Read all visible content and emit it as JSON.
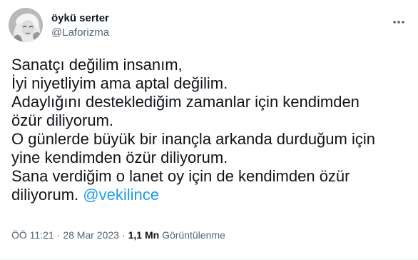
{
  "author": {
    "display_name": "öykü serter",
    "handle": "@Laforizma"
  },
  "tweet": {
    "lines": [
      "Sanatçı değilim insanım,",
      "İyi niyetliyim ama aptal değilim.",
      "Adaylığını desteklediğim zamanlar için kendimden",
      "özür diliyorum.",
      "O günlerde büyük bir inançla arkanda durduğum için",
      "yine kendimden özür diliyorum.",
      "Sana verdiğim o lanet oy için de kendimden özür"
    ],
    "last_line_text": "diliyorum.",
    "mention": "@vekilince"
  },
  "meta": {
    "time": "ÖÖ 11:21",
    "separator": "·",
    "date": "28 Mar 2023",
    "views_count": "1,1 Mn",
    "views_label": "Görüntülenme"
  },
  "icons": {
    "more": "more-dots-icon"
  },
  "colors": {
    "text": "#0f1419",
    "secondary": "#536471",
    "link": "#1d9bf0"
  }
}
